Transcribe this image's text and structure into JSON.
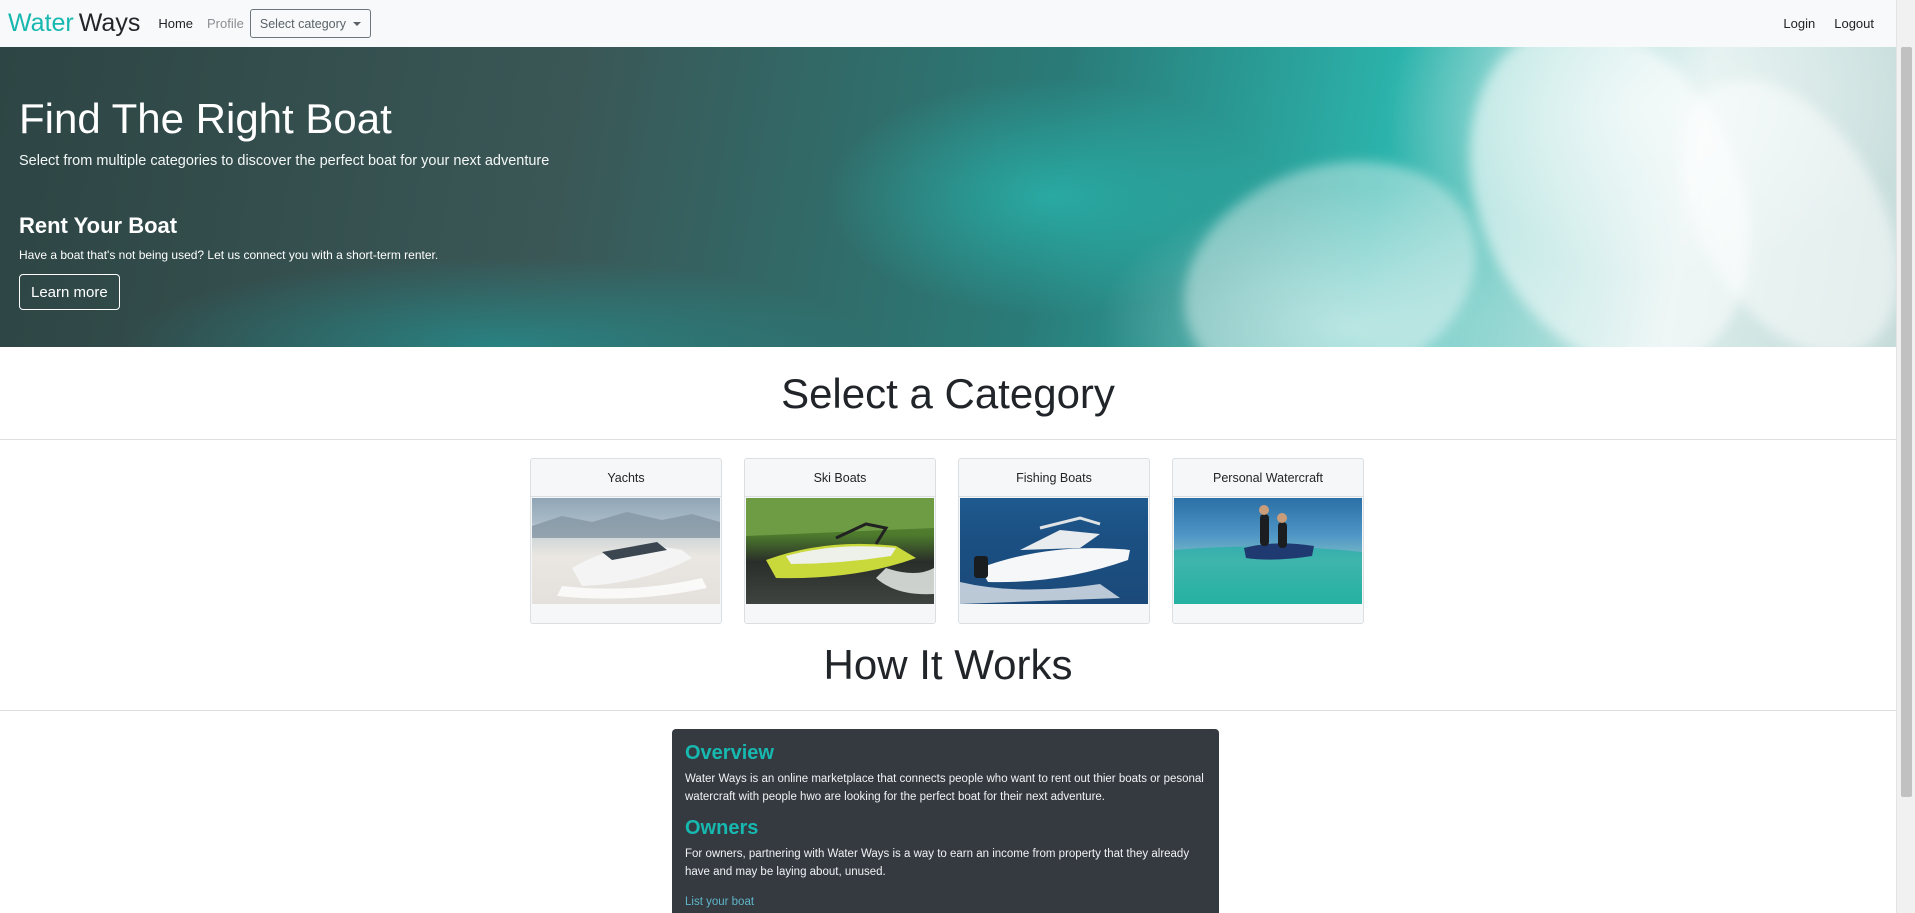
{
  "navbar": {
    "brand_part1": "Water",
    "brand_part2": "Ways",
    "home": "Home",
    "profile": "Profile",
    "select_category": "Select category",
    "login": "Login",
    "logout": "Logout"
  },
  "hero": {
    "title": "Find The Right Boat",
    "subtitle": "Select from multiple categories to discover the perfect boat for your next adventure",
    "rent_title": "Rent Your Boat",
    "rent_subtitle": "Have a boat that's not being used? Let us connect you with a short-term renter.",
    "learn_more": "Learn more"
  },
  "categories": {
    "title": "Select a Category",
    "items": [
      {
        "label": "Yachts"
      },
      {
        "label": "Ski Boats"
      },
      {
        "label": "Fishing Boats"
      },
      {
        "label": "Personal Watercraft"
      }
    ]
  },
  "how": {
    "title": "How It Works",
    "overview_title": "Overview",
    "overview_text": "Water Ways is an online marketplace that connects people who want to rent out thier boats or pesonal watercraft with people hwo are looking for the perfect boat for their next adventure.",
    "owners_title": "Owners",
    "owners_text": "For owners, partnering with Water Ways is a way to earn an income from property that they already have and may be laying about, unused.",
    "list_link": "List your boat"
  },
  "colors": {
    "brand_accent": "#17b8b0",
    "panel_bg": "#343a40",
    "navbar_bg": "#f8f9fa"
  }
}
